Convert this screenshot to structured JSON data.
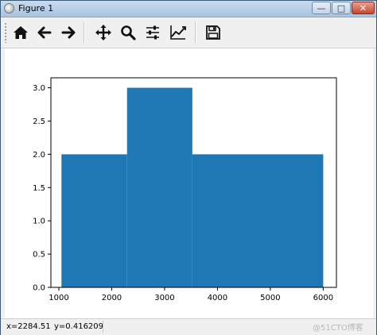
{
  "window": {
    "title": "Figure 1"
  },
  "toolbar": {
    "buttons": [
      {
        "name": "home-button",
        "icon": "home-icon"
      },
      {
        "name": "back-button",
        "icon": "arrow-left-icon"
      },
      {
        "name": "forward-button",
        "icon": "arrow-right-icon"
      },
      {
        "name": "pan-button",
        "icon": "move-icon"
      },
      {
        "name": "zoom-button",
        "icon": "search-icon"
      },
      {
        "name": "configure-subplots-button",
        "icon": "sliders-icon"
      },
      {
        "name": "edit-axis-button",
        "icon": "line-chart-icon"
      },
      {
        "name": "save-button",
        "icon": "floppy-disk-icon"
      }
    ]
  },
  "status": {
    "x_readout": "x=2284.51",
    "y_readout": "y=0.416209"
  },
  "watermark": "@51CTO博客",
  "colors": {
    "bar": "#1f77b4"
  },
  "chart_data": {
    "type": "bar",
    "bins": [
      {
        "x0": 1050,
        "x1": 2290,
        "value": 2
      },
      {
        "x0": 2290,
        "x1": 3525,
        "value": 3
      },
      {
        "x0": 3525,
        "x1": 6000,
        "value": 2
      }
    ],
    "xlim": [
      850,
      6250
    ],
    "ylim": [
      0,
      3.15
    ],
    "xticks": [
      1000,
      2000,
      3000,
      4000,
      5000,
      6000
    ],
    "yticks": [
      0.0,
      0.5,
      1.0,
      1.5,
      2.0,
      2.5,
      3.0
    ],
    "xtick_labels": [
      "1000",
      "2000",
      "3000",
      "4000",
      "5000",
      "6000"
    ],
    "ytick_labels": [
      "0.0",
      "0.5",
      "1.0",
      "1.5",
      "2.0",
      "2.5",
      "3.0"
    ],
    "grid": false
  }
}
